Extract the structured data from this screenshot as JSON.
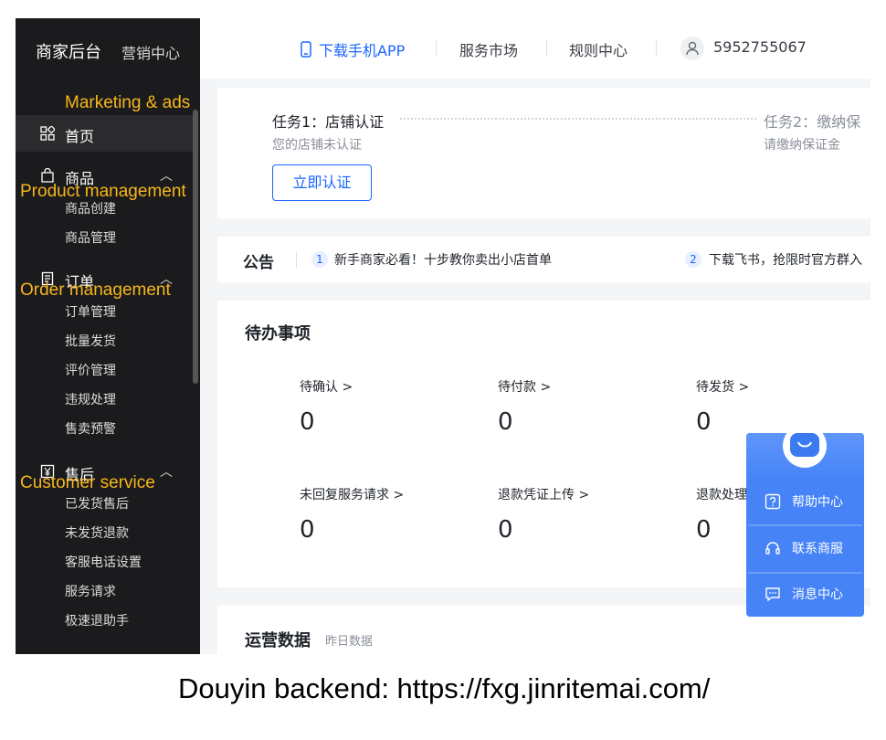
{
  "sidebar": {
    "brand": "商家后台",
    "subtitle": "营销中心",
    "home": "首页",
    "groups": [
      {
        "label": "商品",
        "items": [
          "商品创建",
          "商品管理"
        ]
      },
      {
        "label": "订单",
        "items": [
          "订单管理",
          "批量发货",
          "评价管理",
          "违规处理",
          "售卖预警"
        ]
      },
      {
        "label": "售后",
        "items": [
          "已发货售后",
          "未发货退款",
          "客服电话设置",
          "服务请求",
          "极速退助手"
        ]
      }
    ]
  },
  "annotations": {
    "marketing": "Marketing & ads",
    "product": "Product management",
    "order": "Order management",
    "service": "Customer service",
    "color": "#f7b61a"
  },
  "topbar": {
    "download_app": "下载手机APP",
    "market": "服务市场",
    "rules": "规则中心",
    "account": "5952755067"
  },
  "tasks": {
    "task1_title": "任务1：店铺认证",
    "task1_sub": "您的店铺未认证",
    "task2_title": "任务2：缴纳保",
    "task2_sub": "请缴纳保证金",
    "verify_button": "立即认证"
  },
  "notice": {
    "title": "公告",
    "items": [
      {
        "num": "1",
        "text": "新手商家必看！十步教你卖出小店首单"
      },
      {
        "num": "2",
        "text": "下载飞书，抢限时官方群入"
      }
    ]
  },
  "todo": {
    "title": "待办事项",
    "items": [
      {
        "label": "待确认 >",
        "value": "0"
      },
      {
        "label": "待付款 >",
        "value": "0"
      },
      {
        "label": "待发货 >",
        "value": "0"
      },
      {
        "label": "未回复服务请求 >",
        "value": "0"
      },
      {
        "label": "退款凭证上传 >",
        "value": "0"
      },
      {
        "label": "退款处理",
        "value": "0"
      }
    ]
  },
  "ops": {
    "title": "运营数据",
    "sub": "昨日数据"
  },
  "helper": {
    "help": "帮助中心",
    "contact": "联系商服",
    "messages": "消息中心"
  },
  "caption": "Douyin backend: https://fxg.jinritemai.com/",
  "colors": {
    "accent": "#1966ff",
    "sidebar_bg": "#1b1b1d",
    "helper_bg": "#4583f7"
  }
}
